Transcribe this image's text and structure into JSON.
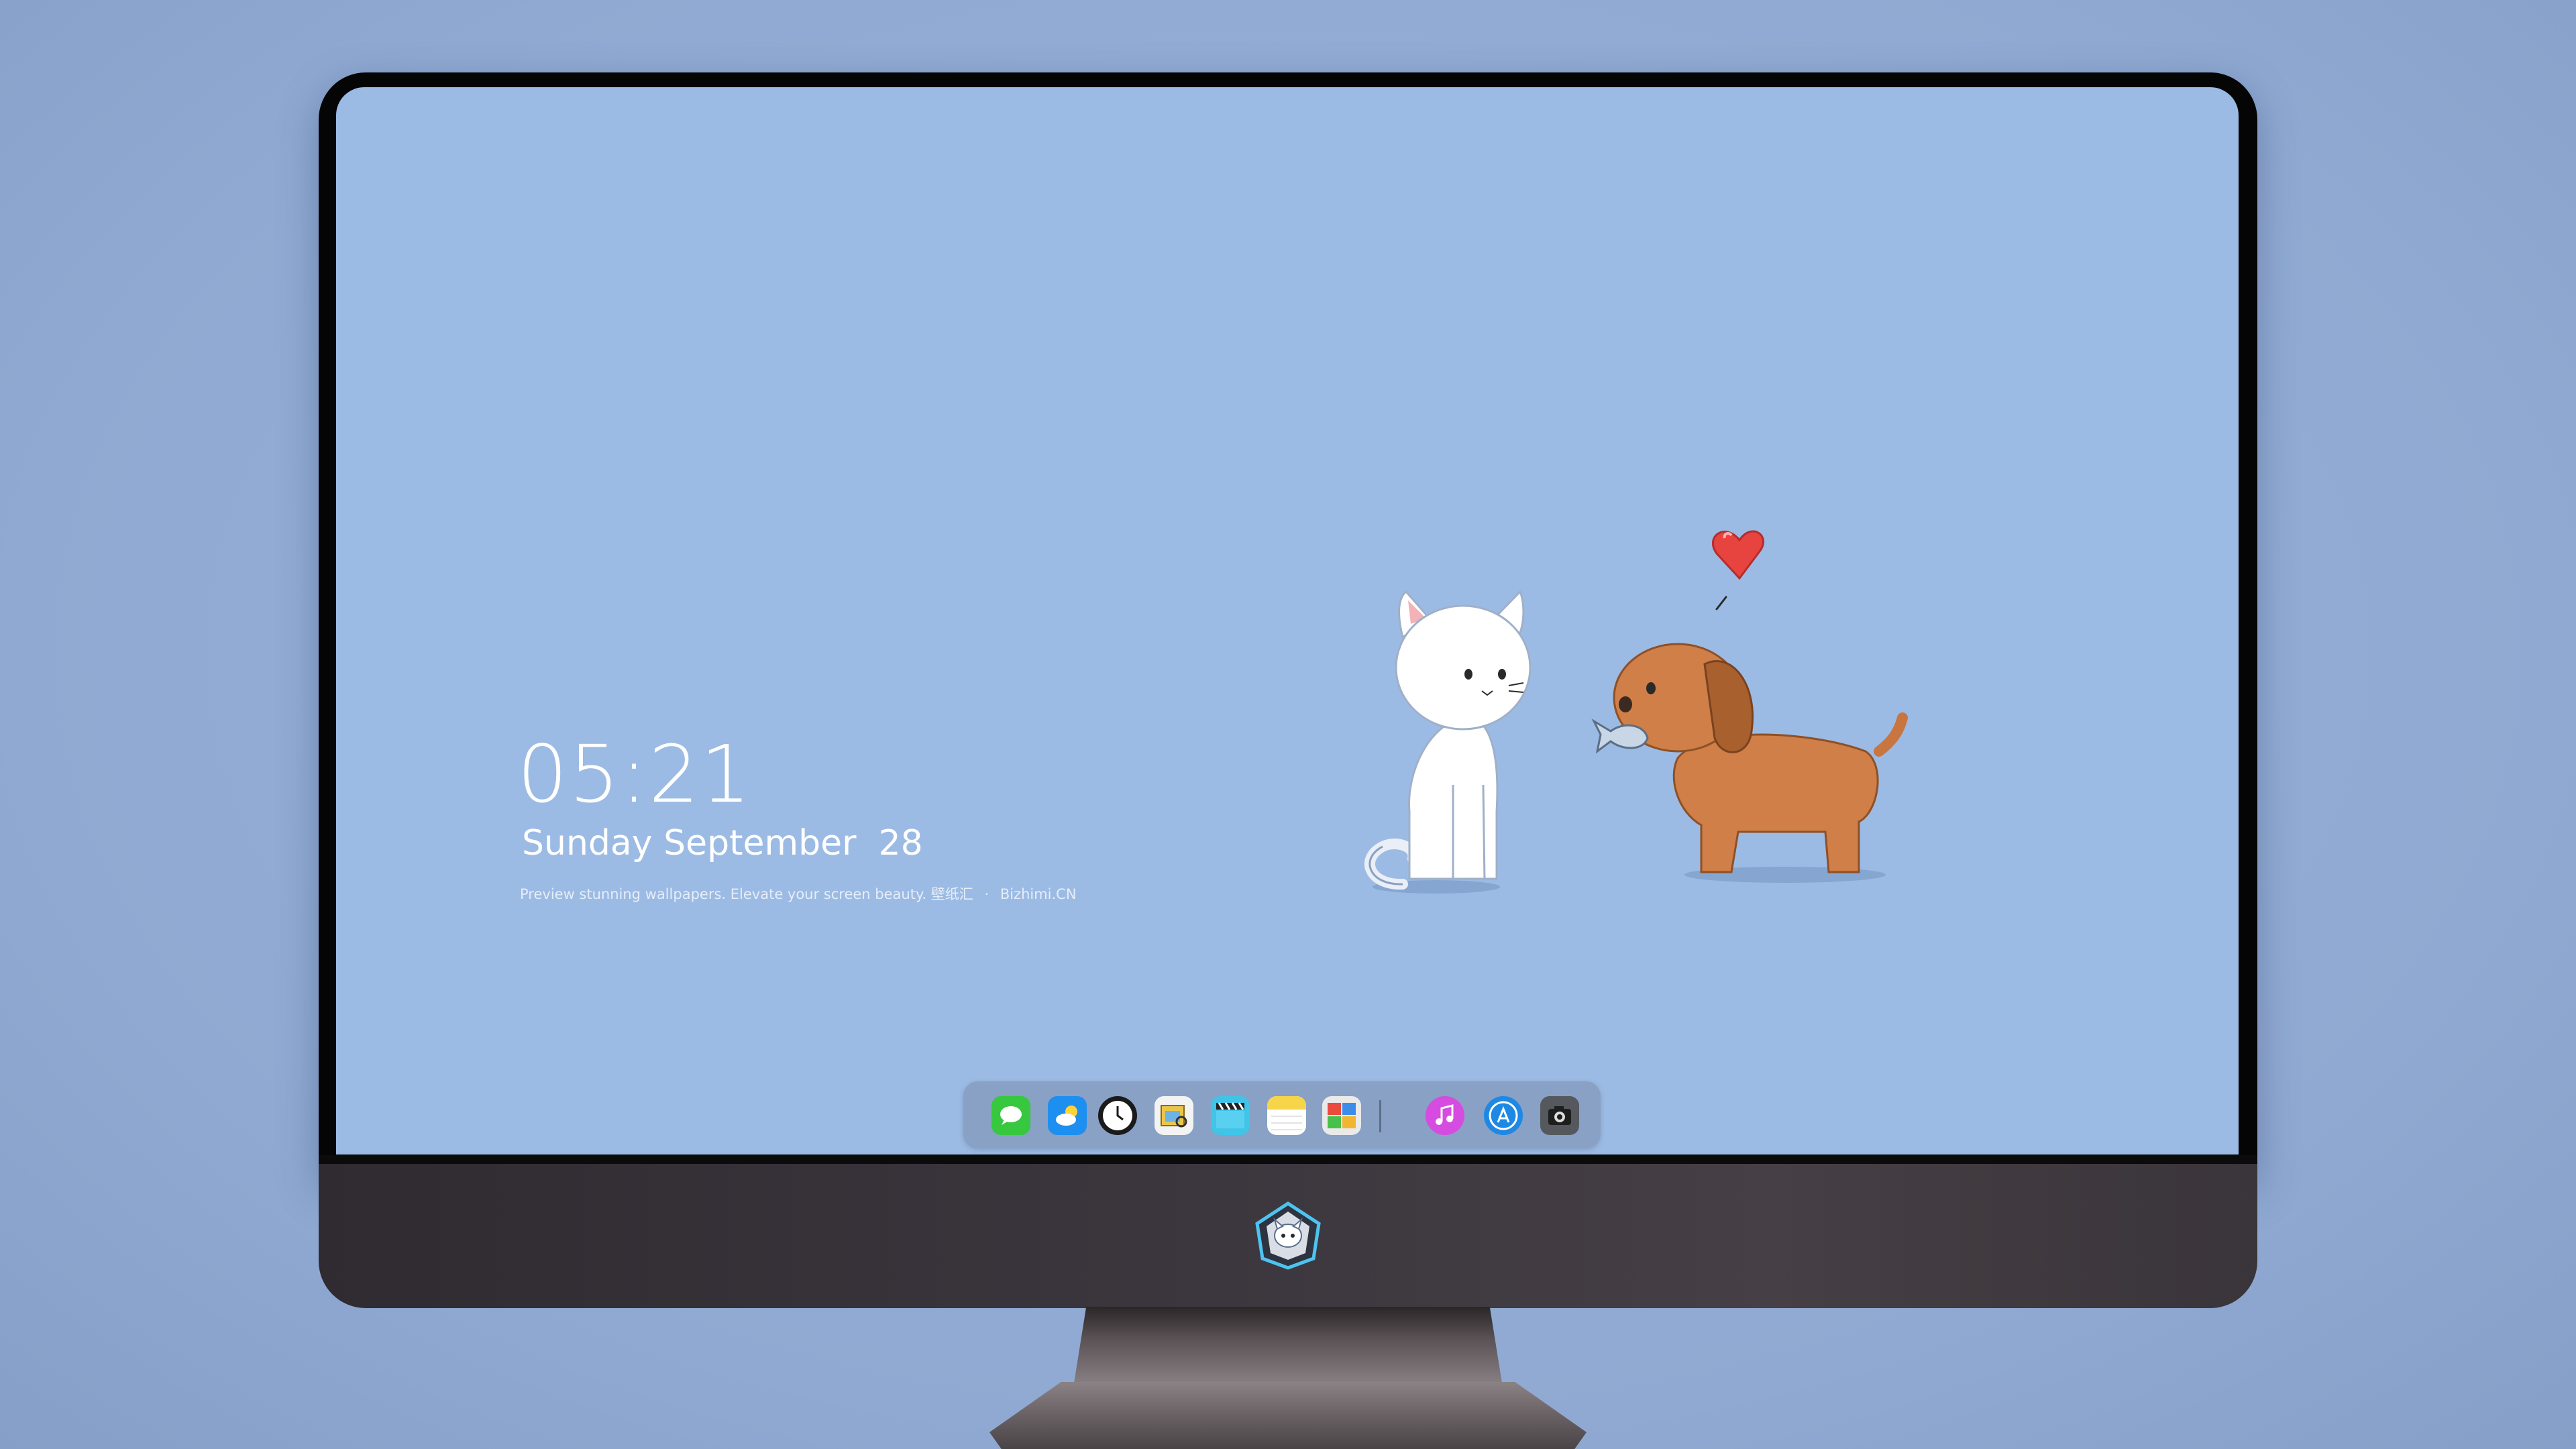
{
  "lock_screen": {
    "time": "05:21",
    "date": "Sunday September  28",
    "tagline": {
      "text": "Preview stunning wallpapers. Elevate your screen beauty.",
      "brand_cn": "壁纸汇",
      "separator": "·",
      "site": "Bizhimi.CN"
    }
  },
  "dock": {
    "apps": [
      {
        "name": "messages-icon",
        "color": "#37c83f"
      },
      {
        "name": "weather-icon",
        "color": "#1d8ff0"
      },
      {
        "name": "clock-icon",
        "color": "#1a1a1a"
      },
      {
        "name": "preview-icon",
        "color": "#e9c64a"
      },
      {
        "name": "video-clapper-icon",
        "color": "#40c4e8"
      },
      {
        "name": "notes-icon",
        "color": "#f7d54a"
      },
      {
        "name": "photo-booth-icon",
        "color": "#eaeaea"
      },
      {
        "name": "itunes-icon",
        "color": "#d64be0"
      },
      {
        "name": "app-store-icon",
        "color": "#1e88e5"
      },
      {
        "name": "camera-icon",
        "color": "#55585d"
      }
    ]
  },
  "colors": {
    "wallpaper": "#9cbbe4",
    "page_background": "#93add6"
  }
}
